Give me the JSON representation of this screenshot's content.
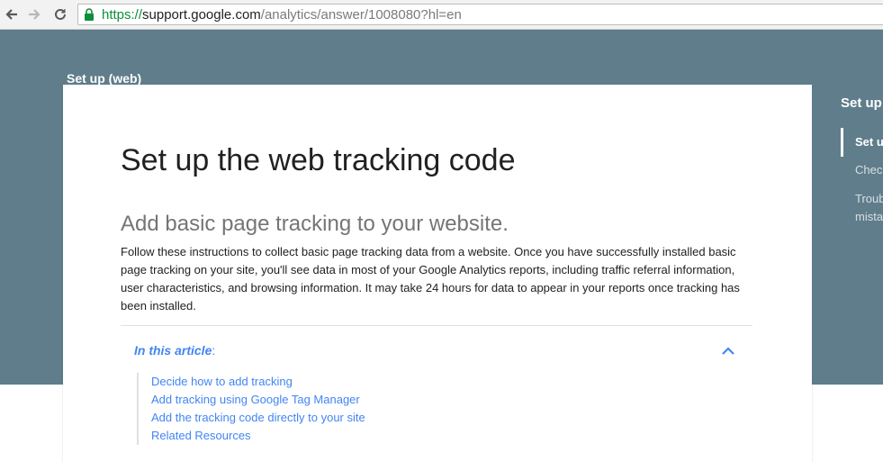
{
  "browser": {
    "url_scheme": "https://",
    "url_host": "support.google.com",
    "url_path": "/analytics/answer/1008080?hl=en"
  },
  "header": {
    "section_title": "Set up (web)"
  },
  "toc": {
    "title": "Set up",
    "items": [
      {
        "label": "Set u",
        "active": true
      },
      {
        "label": "Check"
      },
      {
        "label": "Troub"
      },
      {
        "label": "mista"
      }
    ]
  },
  "article": {
    "title": "Set up the web tracking code",
    "subtitle": "Add basic page tracking to your website.",
    "intro": "Follow these instructions to collect basic page tracking data from a website. Once you have successfully installed basic page tracking on your site, you'll see data in most of your Google Analytics reports, including traffic referral information, user characteristics, and browsing information. It may take 24 hours for data to appear in your reports once tracking has been installed.",
    "in_this_article": "In this article",
    "in_this_article_colon": ":",
    "links": [
      "Decide how to add tracking",
      "Add tracking using Google Tag Manager",
      "Add the tracking code directly to your site",
      "Related Resources"
    ]
  },
  "colors": {
    "band": "#607d8b",
    "link": "#4285f4",
    "secure": "#0b8f3a"
  }
}
